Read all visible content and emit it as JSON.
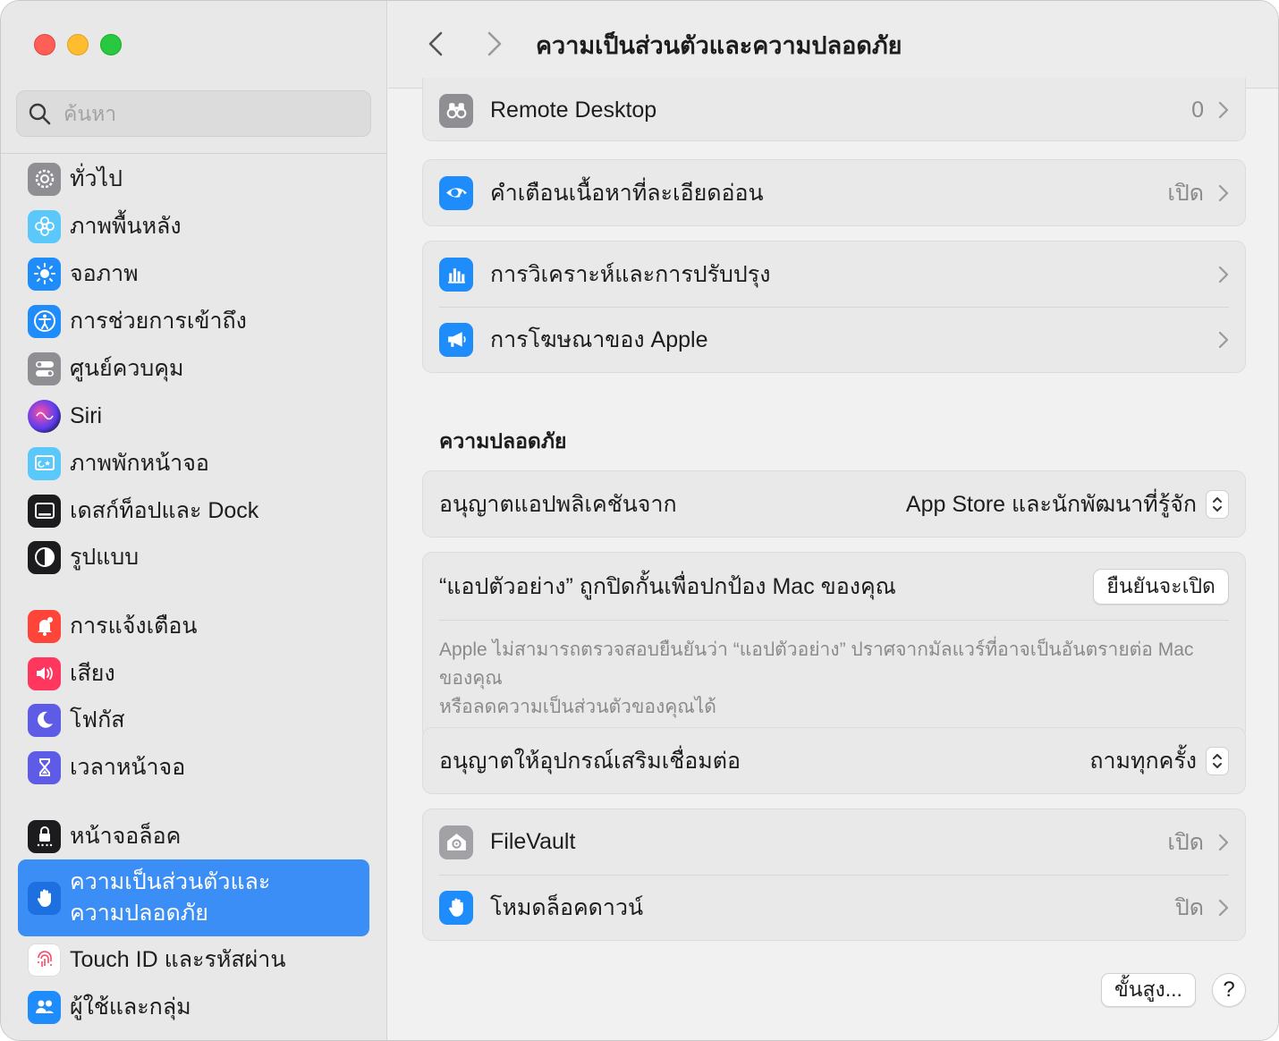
{
  "window": {
    "title": "ความเป็นส่วนตัวและความปลอดภัย"
  },
  "search": {
    "placeholder": "ค้นหา"
  },
  "sidebar": {
    "items": [
      {
        "label": "ทั่วไป",
        "icon": "gear-icon"
      },
      {
        "label": "ภาพพื้นหลัง",
        "icon": "flower-icon"
      },
      {
        "label": "จอภาพ",
        "icon": "sun-icon"
      },
      {
        "label": "การช่วยการเข้าถึง",
        "icon": "accessibility-icon"
      },
      {
        "label": "ศูนย์ควบคุม",
        "icon": "toggles-icon"
      },
      {
        "label": "Siri",
        "icon": "siri-icon"
      },
      {
        "label": "ภาพพักหน้าจอ",
        "icon": "screensaver-icon"
      },
      {
        "label": "เดสก์ท็อปและ Dock",
        "icon": "dock-icon"
      },
      {
        "label": "รูปแบบ",
        "icon": "appearance-icon"
      },
      {
        "label": "การแจ้งเตือน",
        "icon": "bell-icon"
      },
      {
        "label": "เสียง",
        "icon": "speaker-icon"
      },
      {
        "label": "โฟกัส",
        "icon": "moon-icon"
      },
      {
        "label": "เวลาหน้าจอ",
        "icon": "hourglass-icon"
      },
      {
        "label": "หน้าจอล็อค",
        "icon": "lock-icon"
      },
      {
        "label_line1": "ความเป็นส่วนตัวและ",
        "label_line2": "ความปลอดภัย",
        "icon": "hand-icon",
        "selected": true
      },
      {
        "label": "Touch ID และรหัสผ่าน",
        "icon": "fingerprint-icon"
      },
      {
        "label": "ผู้ใช้และกลุ่ม",
        "icon": "users-icon"
      }
    ]
  },
  "privacy": {
    "remote_desktop": {
      "label": "Remote Desktop",
      "value": "0"
    },
    "sensitive_content": {
      "label": "คำเตือนเนื้อหาที่ละเอียดอ่อน",
      "value": "เปิด"
    },
    "analytics": {
      "label": "การวิเคราะห์และการปรับปรุง"
    },
    "apple_ads": {
      "label": "การโฆษณาของ Apple"
    }
  },
  "security": {
    "section_title": "ความปลอดภัย",
    "allow_apps": {
      "label": "อนุญาตแอปพลิเคชันจาก",
      "value": "App Store และนักพัฒนาที่รู้จัก"
    },
    "blocked": {
      "label": "“แอปตัวอย่าง” ถูกปิดกั้นเพื่อปกป้อง Mac ของคุณ",
      "button": "ยืนยันจะเปิด",
      "note_line1": "Apple ไม่สามารถตรวจสอบยืนยันว่า “แอปตัวอย่าง” ปราศจากมัลแวร์ที่อาจเป็นอันตรายต่อ Mac ของคุณ",
      "note_line2": "หรือลดความเป็นส่วนตัวของคุณได้"
    },
    "accessories": {
      "label": "อนุญาตให้อุปกรณ์เสริมเชื่อมต่อ",
      "value": "ถามทุกครั้ง"
    },
    "filevault": {
      "label": "FileVault",
      "value": "เปิด"
    },
    "lockdown": {
      "label": "โหมดล็อคดาวน์",
      "value": "ปิด"
    }
  },
  "footer": {
    "advanced": "ขั้นสูง...",
    "help": "?"
  },
  "colors": {
    "accent": "#3a8ef5",
    "close": "#ff5f57",
    "minimize": "#febc2e",
    "maximize": "#28c840"
  }
}
